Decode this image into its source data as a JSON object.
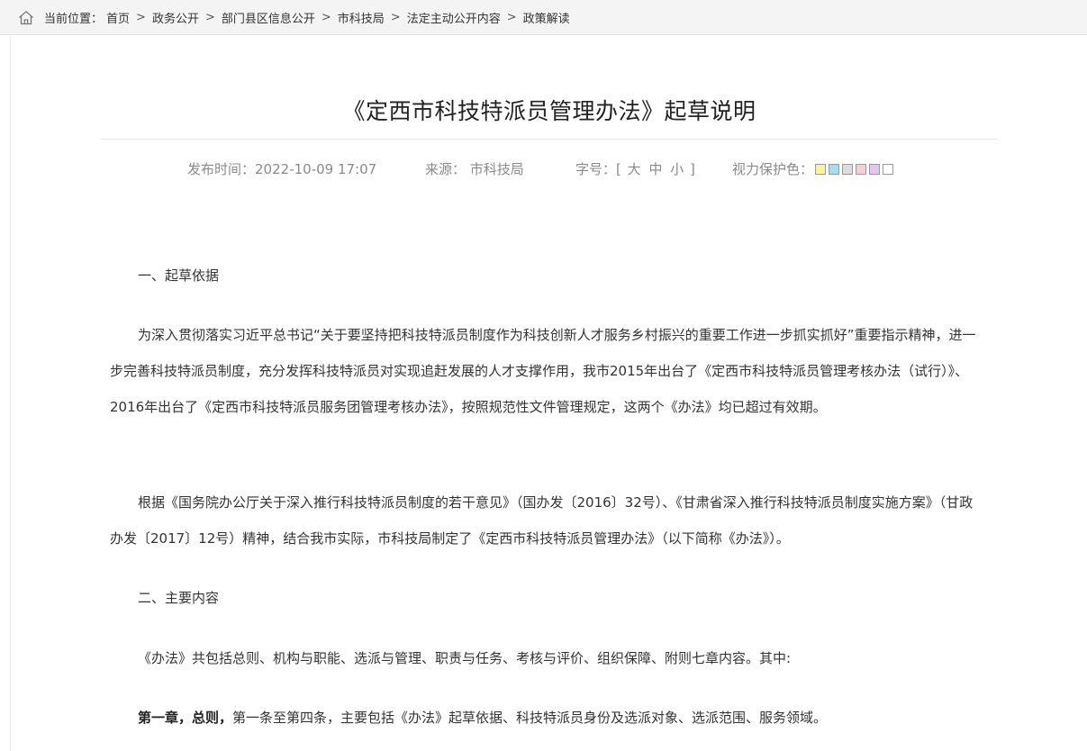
{
  "breadcrumb": {
    "prefix": "当前位置：",
    "items": [
      "首页",
      "政务公开",
      "部门县区信息公开",
      "市科技局",
      "法定主动公开内容",
      "政策解读"
    ],
    "separator": ">"
  },
  "article": {
    "title": "《定西市科技特派员管理办法》起草说明",
    "meta": {
      "publish_label": "发布时间：",
      "publish_time": "2022-10-09 17:07",
      "source_label": "来源：",
      "source": "市科技局",
      "fontsize_label": "字号：",
      "fontsize_open": "[",
      "fontsize_options": [
        "大",
        "中",
        "小"
      ],
      "fontsize_close": "]",
      "eyecare_label": "视力保护色：",
      "eyecare_colors": [
        "#f7f3a3",
        "#a8dcef",
        "#dcdcdc",
        "#f5cfd4",
        "#e2c8f0",
        "#ffffff"
      ]
    },
    "section1_heading": "一、起草依据",
    "para1": "为深入贯彻落实习近平总书记“关于要坚持把科技特派员制度作为科技创新人才服务乡村振兴的重要工作进一步抓实抓好”重要指示精神，进一步完善科技特派员制度，充分发挥科技特派员对实现追赶发展的人才支撑作用，我市2015年出台了《定西市科技特派员管理考核办法（试行）》、2016年出台了《定西市科技特派员服务团管理考核办法》，按照规范性文件管理规定，这两个《办法》均已超过有效期。",
    "para2": "根据《国务院办公厅关于深入推行科技特派员制度的若干意见》（国办发〔2016〕32号）、《甘肃省深入推行科技特派员制度实施方案》（甘政办发〔2017〕12号）精神，结合我市实际，市科技局制定了《定西市科技特派员管理办法》（以下简称《办法》）。",
    "section2_heading": "二、主要内容",
    "para3": "《办法》共包括总则、机构与职能、选派与管理、职责与任务、考核与评价、组织保障、附则七章内容。其中:",
    "para4_bold": "第一章，总则，",
    "para4_text": "第一条至第四条，主要包括《办法》起草依据、科技特派员身份及选派对象、选派范围、服务领域。"
  }
}
